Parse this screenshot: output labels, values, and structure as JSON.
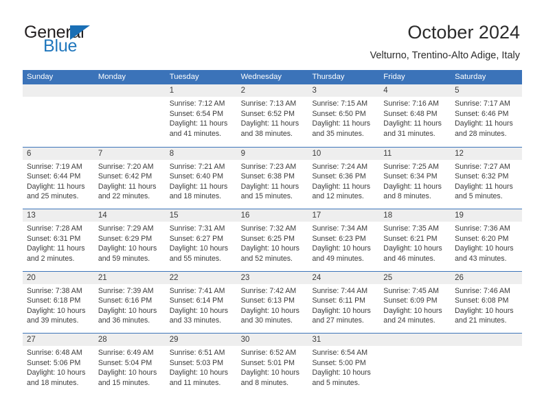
{
  "logo": {
    "word_one": "General",
    "word_two": "Blue",
    "triangle_icon": "triangle-icon",
    "brand_blue": "#2077bd",
    "brand_dark": "#231f20"
  },
  "header": {
    "title": "October 2024",
    "subtitle": "Velturno, Trentino-Alto Adige, Italy"
  },
  "theme": {
    "header_blue": "#3b73b9",
    "band_gray": "#eeeeee",
    "text_dark": "#3a3a3a"
  },
  "calendar": {
    "day_headers": [
      "Sunday",
      "Monday",
      "Tuesday",
      "Wednesday",
      "Thursday",
      "Friday",
      "Saturday"
    ],
    "weeks": [
      [
        {
          "day": "",
          "lines": []
        },
        {
          "day": "",
          "lines": []
        },
        {
          "day": "1",
          "lines": [
            "Sunrise: 7:12 AM",
            "Sunset: 6:54 PM",
            "Daylight: 11 hours",
            "and 41 minutes."
          ]
        },
        {
          "day": "2",
          "lines": [
            "Sunrise: 7:13 AM",
            "Sunset: 6:52 PM",
            "Daylight: 11 hours",
            "and 38 minutes."
          ]
        },
        {
          "day": "3",
          "lines": [
            "Sunrise: 7:15 AM",
            "Sunset: 6:50 PM",
            "Daylight: 11 hours",
            "and 35 minutes."
          ]
        },
        {
          "day": "4",
          "lines": [
            "Sunrise: 7:16 AM",
            "Sunset: 6:48 PM",
            "Daylight: 11 hours",
            "and 31 minutes."
          ]
        },
        {
          "day": "5",
          "lines": [
            "Sunrise: 7:17 AM",
            "Sunset: 6:46 PM",
            "Daylight: 11 hours",
            "and 28 minutes."
          ]
        }
      ],
      [
        {
          "day": "6",
          "lines": [
            "Sunrise: 7:19 AM",
            "Sunset: 6:44 PM",
            "Daylight: 11 hours",
            "and 25 minutes."
          ]
        },
        {
          "day": "7",
          "lines": [
            "Sunrise: 7:20 AM",
            "Sunset: 6:42 PM",
            "Daylight: 11 hours",
            "and 22 minutes."
          ]
        },
        {
          "day": "8",
          "lines": [
            "Sunrise: 7:21 AM",
            "Sunset: 6:40 PM",
            "Daylight: 11 hours",
            "and 18 minutes."
          ]
        },
        {
          "day": "9",
          "lines": [
            "Sunrise: 7:23 AM",
            "Sunset: 6:38 PM",
            "Daylight: 11 hours",
            "and 15 minutes."
          ]
        },
        {
          "day": "10",
          "lines": [
            "Sunrise: 7:24 AM",
            "Sunset: 6:36 PM",
            "Daylight: 11 hours",
            "and 12 minutes."
          ]
        },
        {
          "day": "11",
          "lines": [
            "Sunrise: 7:25 AM",
            "Sunset: 6:34 PM",
            "Daylight: 11 hours",
            "and 8 minutes."
          ]
        },
        {
          "day": "12",
          "lines": [
            "Sunrise: 7:27 AM",
            "Sunset: 6:32 PM",
            "Daylight: 11 hours",
            "and 5 minutes."
          ]
        }
      ],
      [
        {
          "day": "13",
          "lines": [
            "Sunrise: 7:28 AM",
            "Sunset: 6:31 PM",
            "Daylight: 11 hours",
            "and 2 minutes."
          ]
        },
        {
          "day": "14",
          "lines": [
            "Sunrise: 7:29 AM",
            "Sunset: 6:29 PM",
            "Daylight: 10 hours",
            "and 59 minutes."
          ]
        },
        {
          "day": "15",
          "lines": [
            "Sunrise: 7:31 AM",
            "Sunset: 6:27 PM",
            "Daylight: 10 hours",
            "and 55 minutes."
          ]
        },
        {
          "day": "16",
          "lines": [
            "Sunrise: 7:32 AM",
            "Sunset: 6:25 PM",
            "Daylight: 10 hours",
            "and 52 minutes."
          ]
        },
        {
          "day": "17",
          "lines": [
            "Sunrise: 7:34 AM",
            "Sunset: 6:23 PM",
            "Daylight: 10 hours",
            "and 49 minutes."
          ]
        },
        {
          "day": "18",
          "lines": [
            "Sunrise: 7:35 AM",
            "Sunset: 6:21 PM",
            "Daylight: 10 hours",
            "and 46 minutes."
          ]
        },
        {
          "day": "19",
          "lines": [
            "Sunrise: 7:36 AM",
            "Sunset: 6:20 PM",
            "Daylight: 10 hours",
            "and 43 minutes."
          ]
        }
      ],
      [
        {
          "day": "20",
          "lines": [
            "Sunrise: 7:38 AM",
            "Sunset: 6:18 PM",
            "Daylight: 10 hours",
            "and 39 minutes."
          ]
        },
        {
          "day": "21",
          "lines": [
            "Sunrise: 7:39 AM",
            "Sunset: 6:16 PM",
            "Daylight: 10 hours",
            "and 36 minutes."
          ]
        },
        {
          "day": "22",
          "lines": [
            "Sunrise: 7:41 AM",
            "Sunset: 6:14 PM",
            "Daylight: 10 hours",
            "and 33 minutes."
          ]
        },
        {
          "day": "23",
          "lines": [
            "Sunrise: 7:42 AM",
            "Sunset: 6:13 PM",
            "Daylight: 10 hours",
            "and 30 minutes."
          ]
        },
        {
          "day": "24",
          "lines": [
            "Sunrise: 7:44 AM",
            "Sunset: 6:11 PM",
            "Daylight: 10 hours",
            "and 27 minutes."
          ]
        },
        {
          "day": "25",
          "lines": [
            "Sunrise: 7:45 AM",
            "Sunset: 6:09 PM",
            "Daylight: 10 hours",
            "and 24 minutes."
          ]
        },
        {
          "day": "26",
          "lines": [
            "Sunrise: 7:46 AM",
            "Sunset: 6:08 PM",
            "Daylight: 10 hours",
            "and 21 minutes."
          ]
        }
      ],
      [
        {
          "day": "27",
          "lines": [
            "Sunrise: 6:48 AM",
            "Sunset: 5:06 PM",
            "Daylight: 10 hours",
            "and 18 minutes."
          ]
        },
        {
          "day": "28",
          "lines": [
            "Sunrise: 6:49 AM",
            "Sunset: 5:04 PM",
            "Daylight: 10 hours",
            "and 15 minutes."
          ]
        },
        {
          "day": "29",
          "lines": [
            "Sunrise: 6:51 AM",
            "Sunset: 5:03 PM",
            "Daylight: 10 hours",
            "and 11 minutes."
          ]
        },
        {
          "day": "30",
          "lines": [
            "Sunrise: 6:52 AM",
            "Sunset: 5:01 PM",
            "Daylight: 10 hours",
            "and 8 minutes."
          ]
        },
        {
          "day": "31",
          "lines": [
            "Sunrise: 6:54 AM",
            "Sunset: 5:00 PM",
            "Daylight: 10 hours",
            "and 5 minutes."
          ]
        },
        {
          "day": "",
          "lines": []
        },
        {
          "day": "",
          "lines": []
        }
      ]
    ]
  }
}
